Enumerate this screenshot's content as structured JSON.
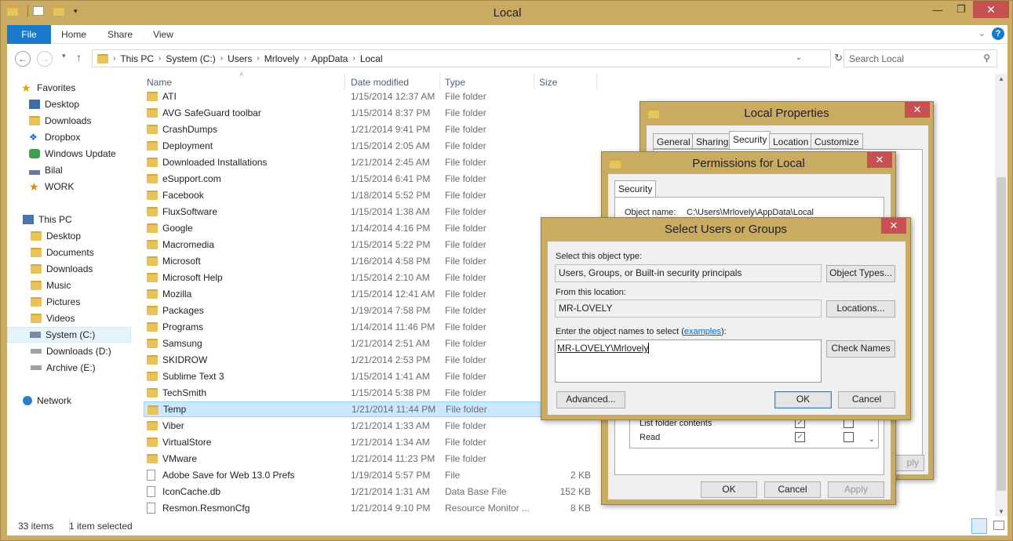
{
  "window": {
    "title": "Local",
    "quick_access_icons": [
      "folder-icon",
      "properties-icon",
      "new-folder-icon",
      "customize-icon"
    ]
  },
  "ribbon": {
    "tabs": [
      "File",
      "Home",
      "Share",
      "View"
    ]
  },
  "address": {
    "crumbs": [
      "This PC",
      "System (C:)",
      "Users",
      "Mrlovely",
      "AppData",
      "Local"
    ],
    "search_placeholder": "Search Local"
  },
  "nav": {
    "favorites_label": "Favorites",
    "favorites": [
      "Desktop",
      "Downloads",
      "Dropbox",
      "Windows Update",
      "Bilal",
      "WORK"
    ],
    "thispc_label": "This PC",
    "thispc": [
      "Desktop",
      "Documents",
      "Downloads",
      "Music",
      "Pictures",
      "Videos",
      "System (C:)",
      "Downloads (D:)",
      "Archive (E:)"
    ],
    "network_label": "Network"
  },
  "columns": {
    "name": "Name",
    "date": "Date modified",
    "type": "Type",
    "size": "Size"
  },
  "files": [
    {
      "name": "ATI",
      "date": "1/15/2014 12:37 AM",
      "type": "File folder",
      "size": ""
    },
    {
      "name": "AVG SafeGuard toolbar",
      "date": "1/15/2014 8:37 PM",
      "type": "File folder",
      "size": ""
    },
    {
      "name": "CrashDumps",
      "date": "1/21/2014 9:41 PM",
      "type": "File folder",
      "size": ""
    },
    {
      "name": "Deployment",
      "date": "1/15/2014 2:05 AM",
      "type": "File folder",
      "size": ""
    },
    {
      "name": "Downloaded Installations",
      "date": "1/21/2014 2:45 AM",
      "type": "File folder",
      "size": ""
    },
    {
      "name": "eSupport.com",
      "date": "1/15/2014 6:41 PM",
      "type": "File folder",
      "size": ""
    },
    {
      "name": "Facebook",
      "date": "1/18/2014 5:52 PM",
      "type": "File folder",
      "size": ""
    },
    {
      "name": "FluxSoftware",
      "date": "1/15/2014 1:38 AM",
      "type": "File folder",
      "size": ""
    },
    {
      "name": "Google",
      "date": "1/14/2014 4:16 PM",
      "type": "File folder",
      "size": ""
    },
    {
      "name": "Macromedia",
      "date": "1/15/2014 5:22 PM",
      "type": "File folder",
      "size": ""
    },
    {
      "name": "Microsoft",
      "date": "1/16/2014 4:58 PM",
      "type": "File folder",
      "size": ""
    },
    {
      "name": "Microsoft Help",
      "date": "1/15/2014 2:10 AM",
      "type": "File folder",
      "size": ""
    },
    {
      "name": "Mozilla",
      "date": "1/15/2014 12:41 AM",
      "type": "File folder",
      "size": ""
    },
    {
      "name": "Packages",
      "date": "1/19/2014 7:58 PM",
      "type": "File folder",
      "size": ""
    },
    {
      "name": "Programs",
      "date": "1/14/2014 11:46 PM",
      "type": "File folder",
      "size": ""
    },
    {
      "name": "Samsung",
      "date": "1/21/2014 2:51 AM",
      "type": "File folder",
      "size": ""
    },
    {
      "name": "SKIDROW",
      "date": "1/21/2014 2:53 PM",
      "type": "File folder",
      "size": ""
    },
    {
      "name": "Sublime Text 3",
      "date": "1/15/2014 1:41 AM",
      "type": "File folder",
      "size": ""
    },
    {
      "name": "TechSmith",
      "date": "1/15/2014 5:38 PM",
      "type": "File folder",
      "size": ""
    },
    {
      "name": "Temp",
      "date": "1/21/2014 11:44 PM",
      "type": "File folder",
      "size": "",
      "selected": true
    },
    {
      "name": "Viber",
      "date": "1/21/2014 1:33 AM",
      "type": "File folder",
      "size": ""
    },
    {
      "name": "VirtualStore",
      "date": "1/21/2014 1:34 AM",
      "type": "File folder",
      "size": ""
    },
    {
      "name": "VMware",
      "date": "1/21/2014 11:23 PM",
      "type": "File folder",
      "size": ""
    },
    {
      "name": "Adobe Save for Web 13.0 Prefs",
      "date": "1/19/2014 5:57 PM",
      "type": "File",
      "size": "2 KB"
    },
    {
      "name": "IconCache.db",
      "date": "1/21/2014 1:31 AM",
      "type": "Data Base File",
      "size": "152 KB"
    },
    {
      "name": "Resmon.ResmonCfg",
      "date": "1/21/2014 9:10 PM",
      "type": "Resource Monitor ...",
      "size": "8 KB"
    }
  ],
  "status": {
    "count": "33 items",
    "selected": "1 item selected"
  },
  "props": {
    "title": "Local Properties",
    "tabs": [
      "General",
      "Sharing",
      "Security",
      "Location",
      "Customize"
    ],
    "apply_fragment": "ply"
  },
  "perms": {
    "title": "Permissions for Local",
    "tab": "Security",
    "object_label": "Object name:",
    "object_value": "C:\\Users\\Mrlovely\\AppData\\Local",
    "rows": [
      {
        "label": "List folder contents",
        "allow": true,
        "deny": false
      },
      {
        "label": "Read",
        "allow": true,
        "deny": false
      }
    ],
    "ok": "OK",
    "cancel": "Cancel",
    "apply": "Apply"
  },
  "select": {
    "title": "Select Users or Groups",
    "type_label": "Select this object type:",
    "type_value": "Users, Groups, or Built-in security principals",
    "object_types_btn": "Object Types...",
    "location_label": "From this location:",
    "location_value": "MR-LOVELY",
    "locations_btn": "Locations...",
    "names_label": "Enter the object names to select (",
    "names_link": "examples",
    "names_label_end": "):",
    "names_value": "MR-LOVELY\\Mrlovely",
    "check_btn": "Check Names",
    "advanced": "Advanced...",
    "ok": "OK",
    "cancel": "Cancel"
  },
  "colors": {
    "accent": "#1979ca",
    "frame": "#c9ab62",
    "close": "#c75050",
    "selection": "#cce8ff"
  }
}
